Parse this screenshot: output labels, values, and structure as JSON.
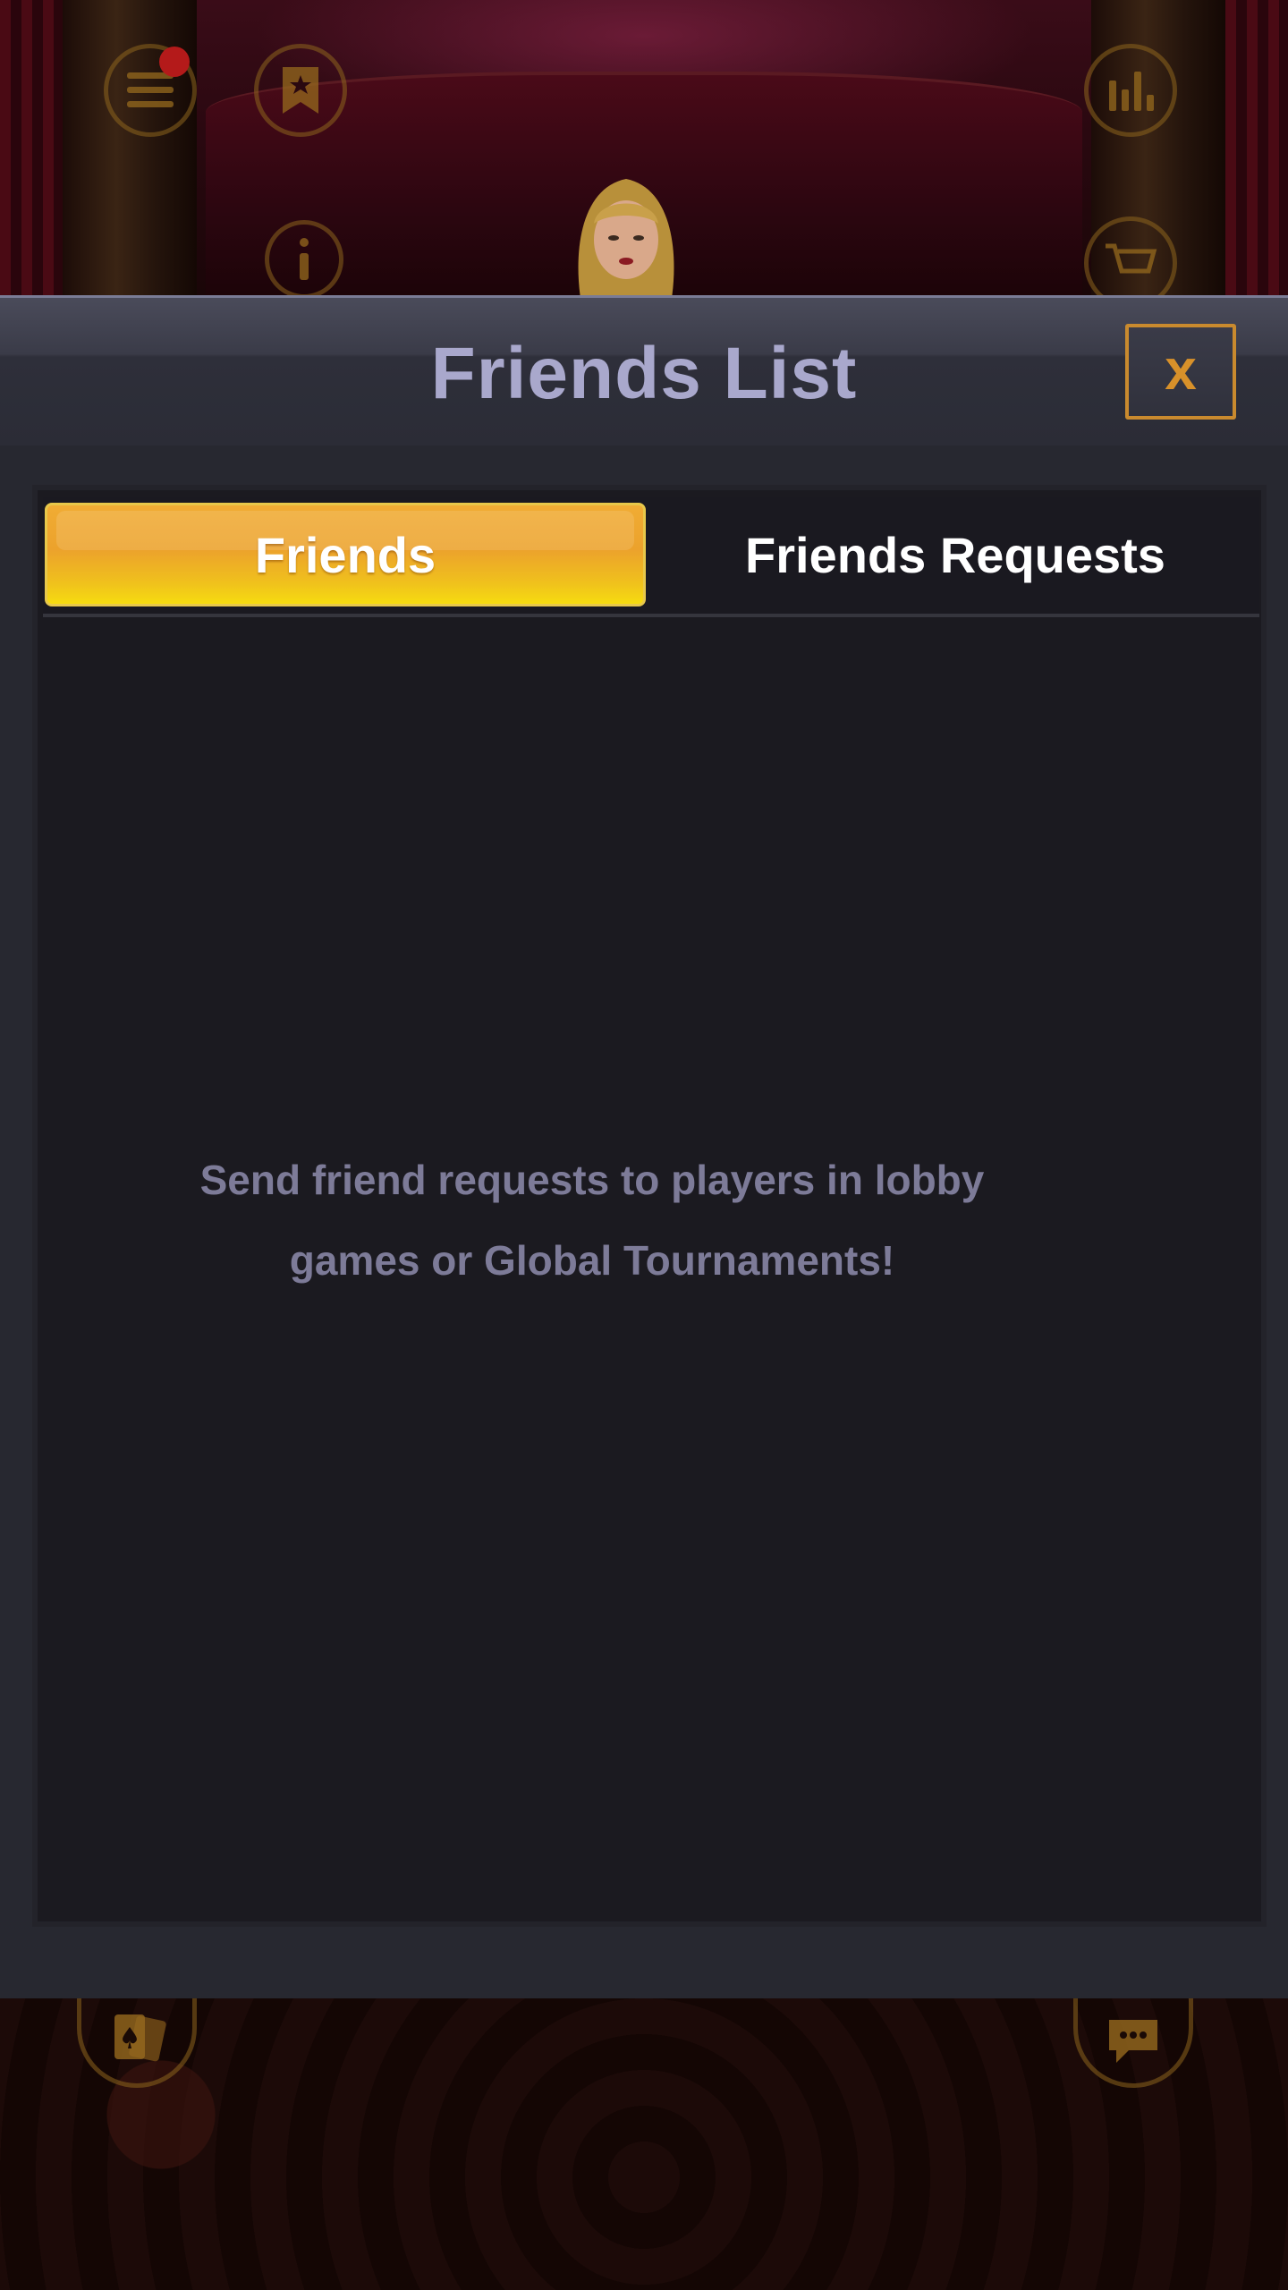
{
  "modal": {
    "title": "Friends List",
    "close_label": "x",
    "tabs": [
      {
        "label": "Friends",
        "active": true
      },
      {
        "label": "Friends Requests",
        "active": false
      }
    ],
    "empty_message": "Send friend requests to players in lobby games or Global Tournaments!"
  },
  "hud": {
    "icons": [
      "menu-icon",
      "bookmark-star-icon",
      "info-icon",
      "stats-icon",
      "cart-icon",
      "cards-icon",
      "chat-icon"
    ],
    "menu_has_notification": true
  },
  "colors": {
    "title": "#a9a8cc",
    "close_accent": "#c98a2e",
    "tab_active_top": "#f0ac34",
    "tab_active_bottom": "#f6dc10",
    "empty_text": "#7d7b98",
    "panel_bg": "#1b1a20",
    "modal_bg": "#272830"
  }
}
